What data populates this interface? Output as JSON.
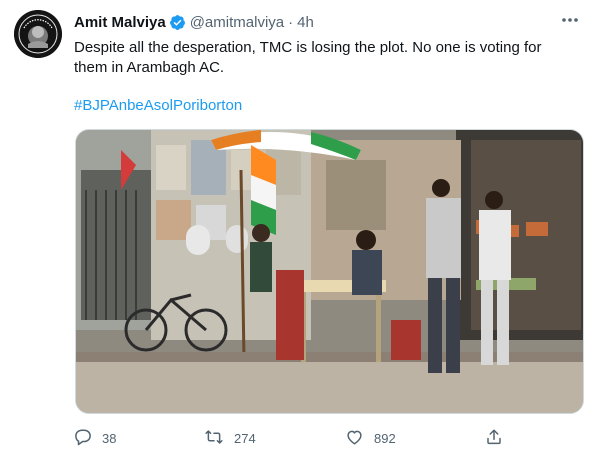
{
  "tweet": {
    "author_name": "Amit Malviya",
    "handle": "@amitmalviya",
    "separator": "·",
    "time": "4h",
    "text": "Despite all the desperation, TMC is losing the plot. No one is voting for them in Arambagh AC.",
    "hashtag": "#BJPAnbeAsolPoriborton",
    "avatar_text": "TRIBUTE TO DAUGHTER OF BENGAL",
    "colors": {
      "accent": "#1d9bf0",
      "muted": "#536471",
      "text": "#0f1419"
    },
    "actions": {
      "reply_count": "38",
      "retweet_count": "274",
      "like_count": "892"
    },
    "icons": [
      "verified-badge-icon",
      "more-icon",
      "reply-icon",
      "retweet-icon",
      "like-icon",
      "share-icon"
    ]
  }
}
